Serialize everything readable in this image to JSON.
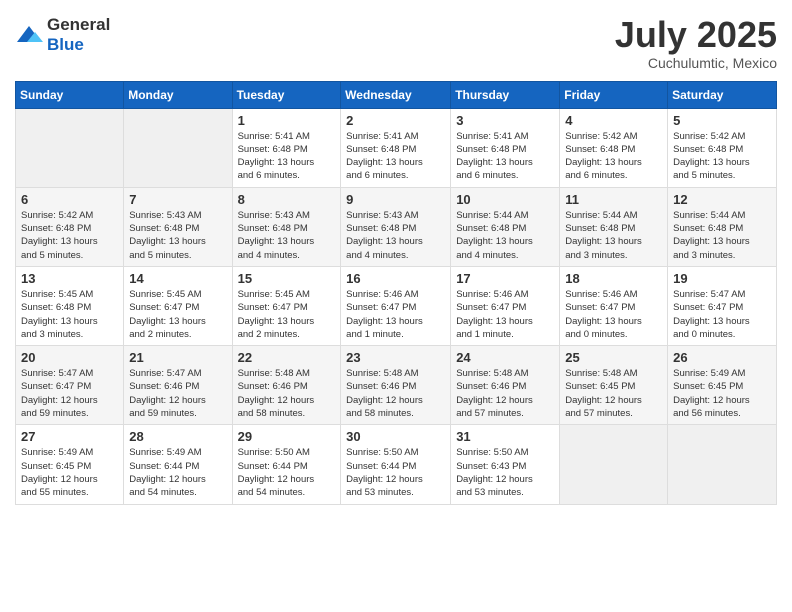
{
  "logo": {
    "general": "General",
    "blue": "Blue"
  },
  "title": {
    "month_year": "July 2025",
    "location": "Cuchulumtic, Mexico"
  },
  "headers": [
    "Sunday",
    "Monday",
    "Tuesday",
    "Wednesday",
    "Thursday",
    "Friday",
    "Saturday"
  ],
  "weeks": [
    [
      {
        "day": "",
        "info": ""
      },
      {
        "day": "",
        "info": ""
      },
      {
        "day": "1",
        "info": "Sunrise: 5:41 AM\nSunset: 6:48 PM\nDaylight: 13 hours\nand 6 minutes."
      },
      {
        "day": "2",
        "info": "Sunrise: 5:41 AM\nSunset: 6:48 PM\nDaylight: 13 hours\nand 6 minutes."
      },
      {
        "day": "3",
        "info": "Sunrise: 5:41 AM\nSunset: 6:48 PM\nDaylight: 13 hours\nand 6 minutes."
      },
      {
        "day": "4",
        "info": "Sunrise: 5:42 AM\nSunset: 6:48 PM\nDaylight: 13 hours\nand 6 minutes."
      },
      {
        "day": "5",
        "info": "Sunrise: 5:42 AM\nSunset: 6:48 PM\nDaylight: 13 hours\nand 5 minutes."
      }
    ],
    [
      {
        "day": "6",
        "info": "Sunrise: 5:42 AM\nSunset: 6:48 PM\nDaylight: 13 hours\nand 5 minutes."
      },
      {
        "day": "7",
        "info": "Sunrise: 5:43 AM\nSunset: 6:48 PM\nDaylight: 13 hours\nand 5 minutes."
      },
      {
        "day": "8",
        "info": "Sunrise: 5:43 AM\nSunset: 6:48 PM\nDaylight: 13 hours\nand 4 minutes."
      },
      {
        "day": "9",
        "info": "Sunrise: 5:43 AM\nSunset: 6:48 PM\nDaylight: 13 hours\nand 4 minutes."
      },
      {
        "day": "10",
        "info": "Sunrise: 5:44 AM\nSunset: 6:48 PM\nDaylight: 13 hours\nand 4 minutes."
      },
      {
        "day": "11",
        "info": "Sunrise: 5:44 AM\nSunset: 6:48 PM\nDaylight: 13 hours\nand 3 minutes."
      },
      {
        "day": "12",
        "info": "Sunrise: 5:44 AM\nSunset: 6:48 PM\nDaylight: 13 hours\nand 3 minutes."
      }
    ],
    [
      {
        "day": "13",
        "info": "Sunrise: 5:45 AM\nSunset: 6:48 PM\nDaylight: 13 hours\nand 3 minutes."
      },
      {
        "day": "14",
        "info": "Sunrise: 5:45 AM\nSunset: 6:47 PM\nDaylight: 13 hours\nand 2 minutes."
      },
      {
        "day": "15",
        "info": "Sunrise: 5:45 AM\nSunset: 6:47 PM\nDaylight: 13 hours\nand 2 minutes."
      },
      {
        "day": "16",
        "info": "Sunrise: 5:46 AM\nSunset: 6:47 PM\nDaylight: 13 hours\nand 1 minute."
      },
      {
        "day": "17",
        "info": "Sunrise: 5:46 AM\nSunset: 6:47 PM\nDaylight: 13 hours\nand 1 minute."
      },
      {
        "day": "18",
        "info": "Sunrise: 5:46 AM\nSunset: 6:47 PM\nDaylight: 13 hours\nand 0 minutes."
      },
      {
        "day": "19",
        "info": "Sunrise: 5:47 AM\nSunset: 6:47 PM\nDaylight: 13 hours\nand 0 minutes."
      }
    ],
    [
      {
        "day": "20",
        "info": "Sunrise: 5:47 AM\nSunset: 6:47 PM\nDaylight: 12 hours\nand 59 minutes."
      },
      {
        "day": "21",
        "info": "Sunrise: 5:47 AM\nSunset: 6:46 PM\nDaylight: 12 hours\nand 59 minutes."
      },
      {
        "day": "22",
        "info": "Sunrise: 5:48 AM\nSunset: 6:46 PM\nDaylight: 12 hours\nand 58 minutes."
      },
      {
        "day": "23",
        "info": "Sunrise: 5:48 AM\nSunset: 6:46 PM\nDaylight: 12 hours\nand 58 minutes."
      },
      {
        "day": "24",
        "info": "Sunrise: 5:48 AM\nSunset: 6:46 PM\nDaylight: 12 hours\nand 57 minutes."
      },
      {
        "day": "25",
        "info": "Sunrise: 5:48 AM\nSunset: 6:45 PM\nDaylight: 12 hours\nand 57 minutes."
      },
      {
        "day": "26",
        "info": "Sunrise: 5:49 AM\nSunset: 6:45 PM\nDaylight: 12 hours\nand 56 minutes."
      }
    ],
    [
      {
        "day": "27",
        "info": "Sunrise: 5:49 AM\nSunset: 6:45 PM\nDaylight: 12 hours\nand 55 minutes."
      },
      {
        "day": "28",
        "info": "Sunrise: 5:49 AM\nSunset: 6:44 PM\nDaylight: 12 hours\nand 54 minutes."
      },
      {
        "day": "29",
        "info": "Sunrise: 5:50 AM\nSunset: 6:44 PM\nDaylight: 12 hours\nand 54 minutes."
      },
      {
        "day": "30",
        "info": "Sunrise: 5:50 AM\nSunset: 6:44 PM\nDaylight: 12 hours\nand 53 minutes."
      },
      {
        "day": "31",
        "info": "Sunrise: 5:50 AM\nSunset: 6:43 PM\nDaylight: 12 hours\nand 53 minutes."
      },
      {
        "day": "",
        "info": ""
      },
      {
        "day": "",
        "info": ""
      }
    ]
  ]
}
